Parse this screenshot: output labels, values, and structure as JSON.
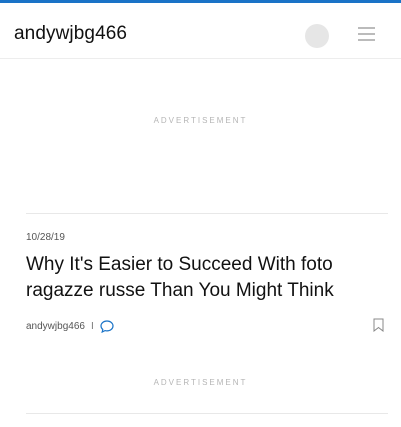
{
  "header": {
    "site_title": "andywjbg466"
  },
  "ads": {
    "label_1": "ADVERTISEMENT",
    "label_2": "ADVERTISEMENT"
  },
  "post": {
    "date": "10/28/19",
    "title": "Why It's Easier to Succeed With foto ragazze russe Than You Might Think",
    "author": "andywjbg466",
    "separator": "I"
  },
  "icons": {
    "menu": "hamburger-menu-icon",
    "comment": "speech-bubble-icon",
    "bookmark": "bookmark-icon"
  },
  "colors": {
    "accent": "#1a73c7",
    "avatar": "#e6e6e6"
  }
}
